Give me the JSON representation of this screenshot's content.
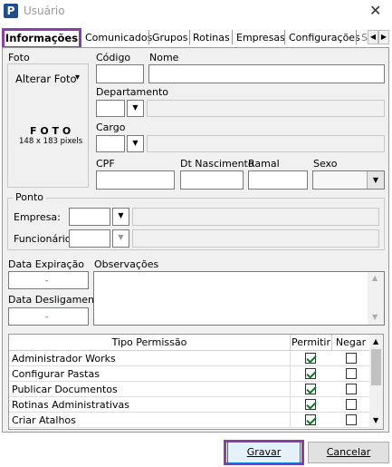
{
  "window": {
    "title": "Usuário",
    "icon_letter": "P",
    "close_glyph": "✕"
  },
  "tabs": [
    "Informações",
    "Comunicados",
    "Grupos",
    "Rotinas",
    "Empresas",
    "Configurações",
    "S"
  ],
  "foto": {
    "label": "Foto",
    "alterar": "Alterar Foto",
    "alterar_arrow": "▾",
    "title": "F O T O",
    "size": "148 x 183 pixels"
  },
  "fields": {
    "codigo": "Código",
    "nome": "Nome",
    "departamento": "Departamento",
    "cargo": "Cargo",
    "cpf": "CPF",
    "dt_nascimento": "Dt Nascimento",
    "ramal": "Ramal",
    "sexo": "Sexo"
  },
  "ponto": {
    "title": "Ponto",
    "empresa": "Empresa:",
    "funcionario": "Funcionário:"
  },
  "dates": {
    "expiracao": "Data Expiração",
    "desligamento": "Data Desligamento",
    "date_mark": "-"
  },
  "observacoes": "Observações",
  "grid": {
    "headers": [
      "Tipo Permissão",
      "Permitir",
      "Negar"
    ],
    "rows": [
      {
        "tipo": "Administrador Works",
        "permitir": true,
        "negar": false
      },
      {
        "tipo": "Configurar Pastas",
        "permitir": true,
        "negar": false
      },
      {
        "tipo": "Publicar Documentos",
        "permitir": true,
        "negar": false
      },
      {
        "tipo": "Rotinas Administrativas",
        "permitir": true,
        "negar": false
      },
      {
        "tipo": "Criar Atalhos",
        "permitir": true,
        "negar": false
      }
    ]
  },
  "buttons": {
    "gravar": "Gravar",
    "cancelar": "Cancelar"
  },
  "arrows": {
    "down": "▼",
    "up": "▲",
    "left": "◀",
    "right": "▶"
  },
  "colors": {
    "highlight": "#8b3fa6",
    "check": "#0a7a28"
  }
}
